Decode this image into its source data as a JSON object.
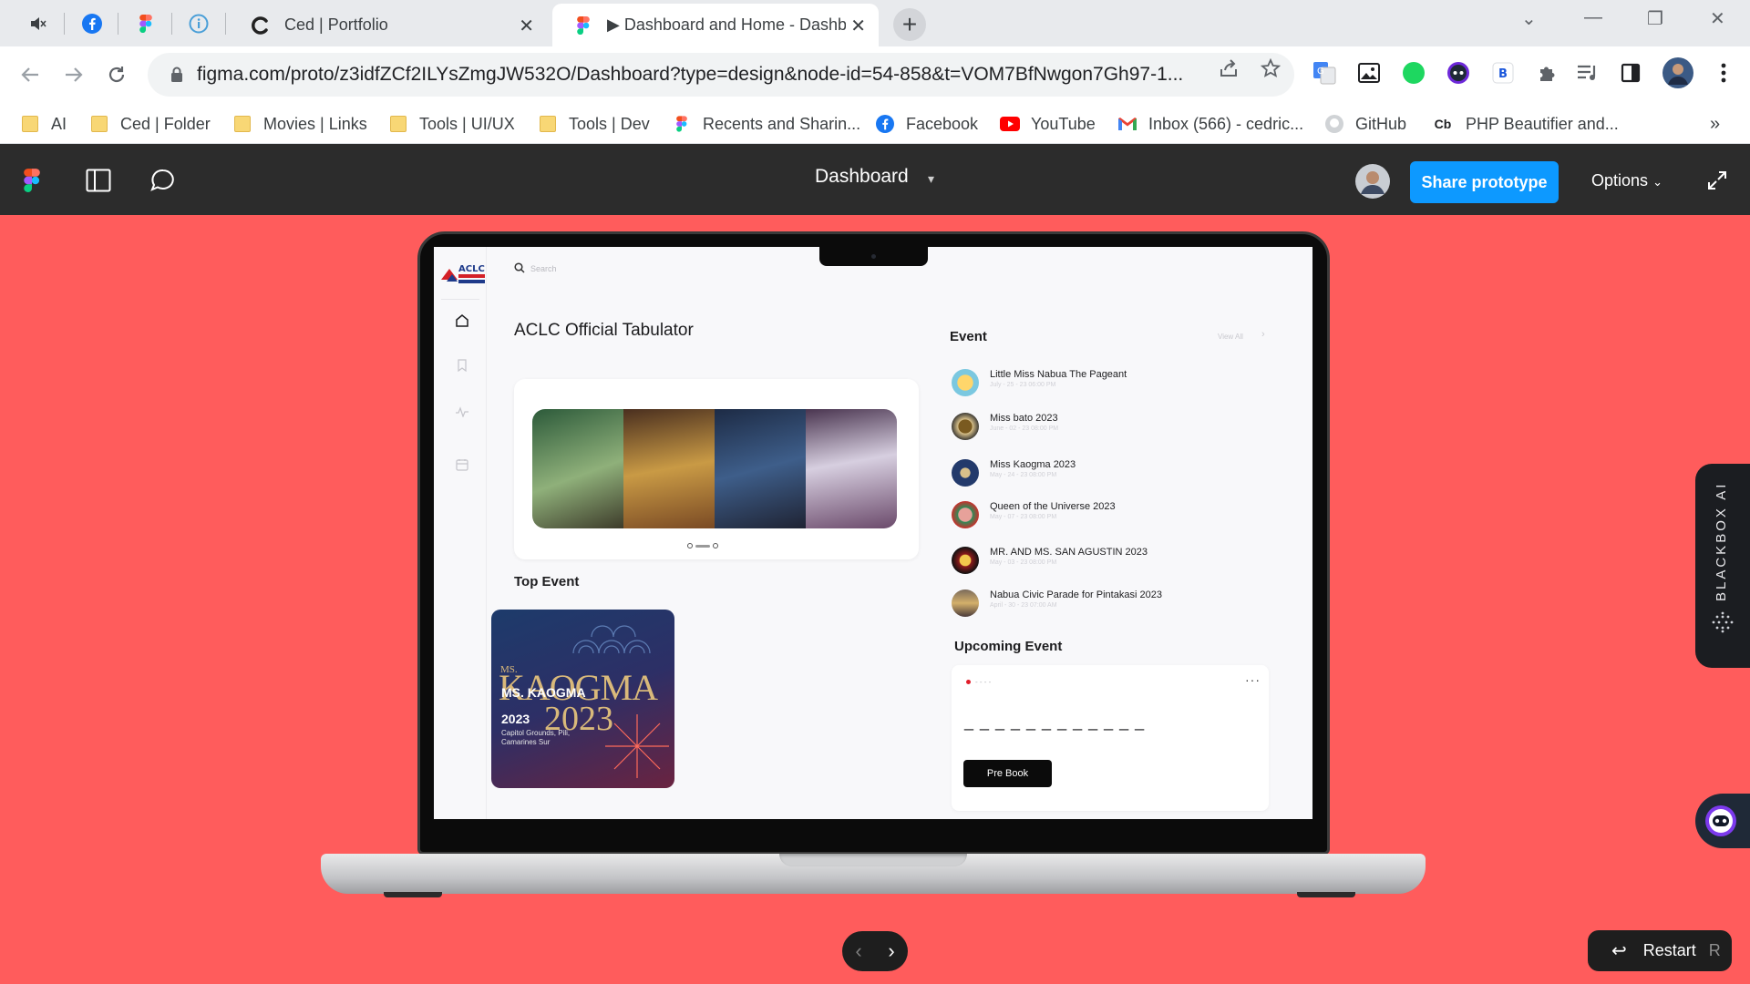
{
  "browser": {
    "tabs": [
      {
        "title": "Ced | Portfolio",
        "icon": "c-logo-icon"
      },
      {
        "title": "▶ Dashboard and Home - Dashb",
        "icon": "figma-icon"
      }
    ],
    "pinned_tabs": [
      "speaker-muted-icon",
      "facebook-icon",
      "figma-icon",
      "info-icon"
    ],
    "url": "figma.com/proto/z3idfZCf2ILYsZmgJW532O/Dashboard?type=design&node-id=54-858&t=VOM7BfNwgon7Gh97-1...",
    "bookmarks": [
      {
        "label": "AI",
        "icon": "folder-icon"
      },
      {
        "label": "Ced | Folder",
        "icon": "folder-icon"
      },
      {
        "label": "Movies | Links",
        "icon": "folder-icon"
      },
      {
        "label": "Tools | UI/UX",
        "icon": "folder-icon"
      },
      {
        "label": "Tools | Dev",
        "icon": "folder-icon"
      },
      {
        "label": "Recents and Sharin...",
        "icon": "figma-icon"
      },
      {
        "label": "Facebook",
        "icon": "facebook-icon"
      },
      {
        "label": "YouTube",
        "icon": "youtube-icon"
      },
      {
        "label": "Inbox (566) - cedric...",
        "icon": "gmail-icon"
      },
      {
        "label": "GitHub",
        "icon": "github-icon"
      },
      {
        "label": "PHP Beautifier and...",
        "icon": "cb-icon"
      }
    ],
    "bookmarks_overflow": "»"
  },
  "figma": {
    "title": "Dashboard",
    "share_label": "Share prototype",
    "options_label": "Options",
    "restart_label": "Restart",
    "restart_key": "R",
    "accent": "#0d99ff",
    "canvas_bg": "#ff5c5c"
  },
  "app": {
    "search_placeholder": "Search",
    "title": "ACLC Official Tabulator",
    "top_event_label": "Top Event",
    "top_event_card": {
      "line1": "MS.",
      "big": "KAOGMA",
      "year": "2023",
      "name": "MS. KAOGMA",
      "year_small": "2023",
      "location": "Capitol Grounds, Pili,",
      "location2": "Camarines Sur"
    },
    "event_heading": "Event",
    "view_all": "View All",
    "events": [
      {
        "name": "Little Miss Nabua The Pageant",
        "date": "July - 25 - 23    06:00 PM"
      },
      {
        "name": "Miss bato 2023",
        "date": "June - 02 - 23    08:00 PM"
      },
      {
        "name": "Miss Kaogma 2023",
        "date": "May - 24 - 23    08:00 PM"
      },
      {
        "name": "Queen of the Universe 2023",
        "date": "May - 07 - 23    08:00 PM"
      },
      {
        "name": "MR. AND MS. SAN AGUSTIN 2023",
        "date": "May - 03 - 23    08:00 PM"
      },
      {
        "name": "Nabua Civic Parade for Pintakasi 2023",
        "date": "April - 30 - 23    07:00 AM"
      }
    ],
    "upcoming_heading": "Upcoming Event",
    "upcoming": {
      "small": "- - - -",
      "title": "_ _ _ _ _ _ _ _ _ _ _ _",
      "more": "···",
      "button": "Pre Book"
    }
  },
  "widgets": {
    "blackbox_label": "BLACKBOX AI"
  }
}
